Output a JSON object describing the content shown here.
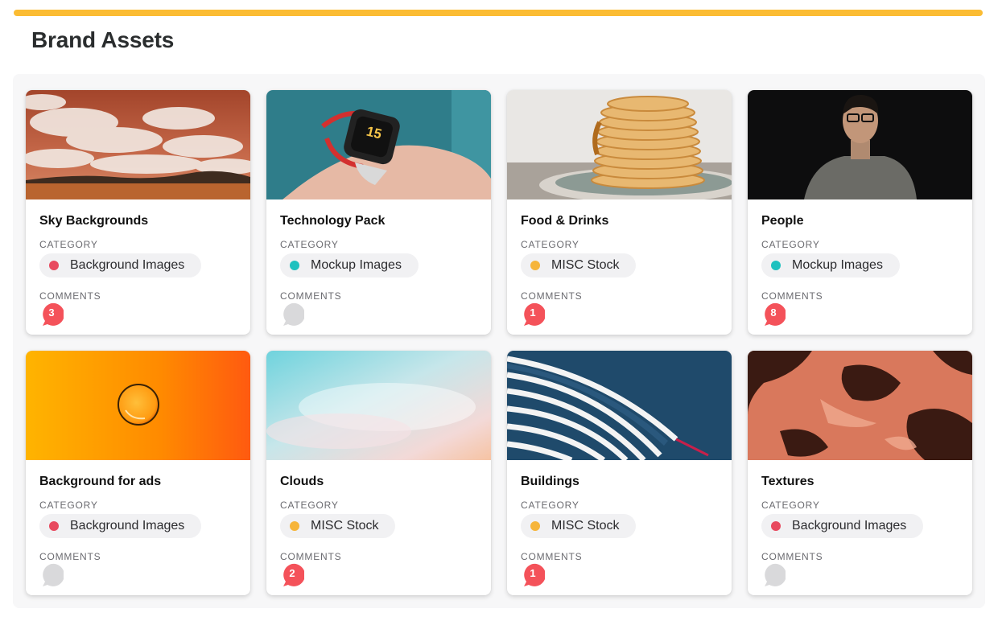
{
  "page": {
    "title": "Brand Assets"
  },
  "colors": {
    "accent_bar": "#fbbc33",
    "dot_background": "#e84a5f",
    "dot_mockup": "#1fc1bf",
    "dot_misc": "#f6b53b",
    "badge_active": "#f4525a",
    "badge_empty": "#d9d9db"
  },
  "labels": {
    "category": "CATEGORY",
    "comments": "COMMENTS"
  },
  "cards": [
    {
      "title": "Sky Backgrounds",
      "image": "sky-clouds",
      "category": "Background Images",
      "dot": "#e84a5f",
      "comments": "3"
    },
    {
      "title": "Technology Pack",
      "image": "smartwatch",
      "category": "Mockup Images",
      "dot": "#1fc1bf",
      "comments": ""
    },
    {
      "title": "Food & Drinks",
      "image": "pancakes",
      "category": "MISC Stock",
      "dot": "#f6b53b",
      "comments": "1"
    },
    {
      "title": "People",
      "image": "portrait",
      "category": "Mockup Images",
      "dot": "#1fc1bf",
      "comments": "8"
    },
    {
      "title": "Background for ads",
      "image": "orange-bubble",
      "category": "Background Images",
      "dot": "#e84a5f",
      "comments": ""
    },
    {
      "title": "Clouds",
      "image": "pastel-clouds",
      "category": "MISC Stock",
      "dot": "#f6b53b",
      "comments": "2"
    },
    {
      "title": "Buildings",
      "image": "skyscraper",
      "category": "MISC Stock",
      "dot": "#f6b53b",
      "comments": "1"
    },
    {
      "title": "Textures",
      "image": "marble-texture",
      "category": "Background Images",
      "dot": "#e84a5f",
      "comments": ""
    }
  ]
}
